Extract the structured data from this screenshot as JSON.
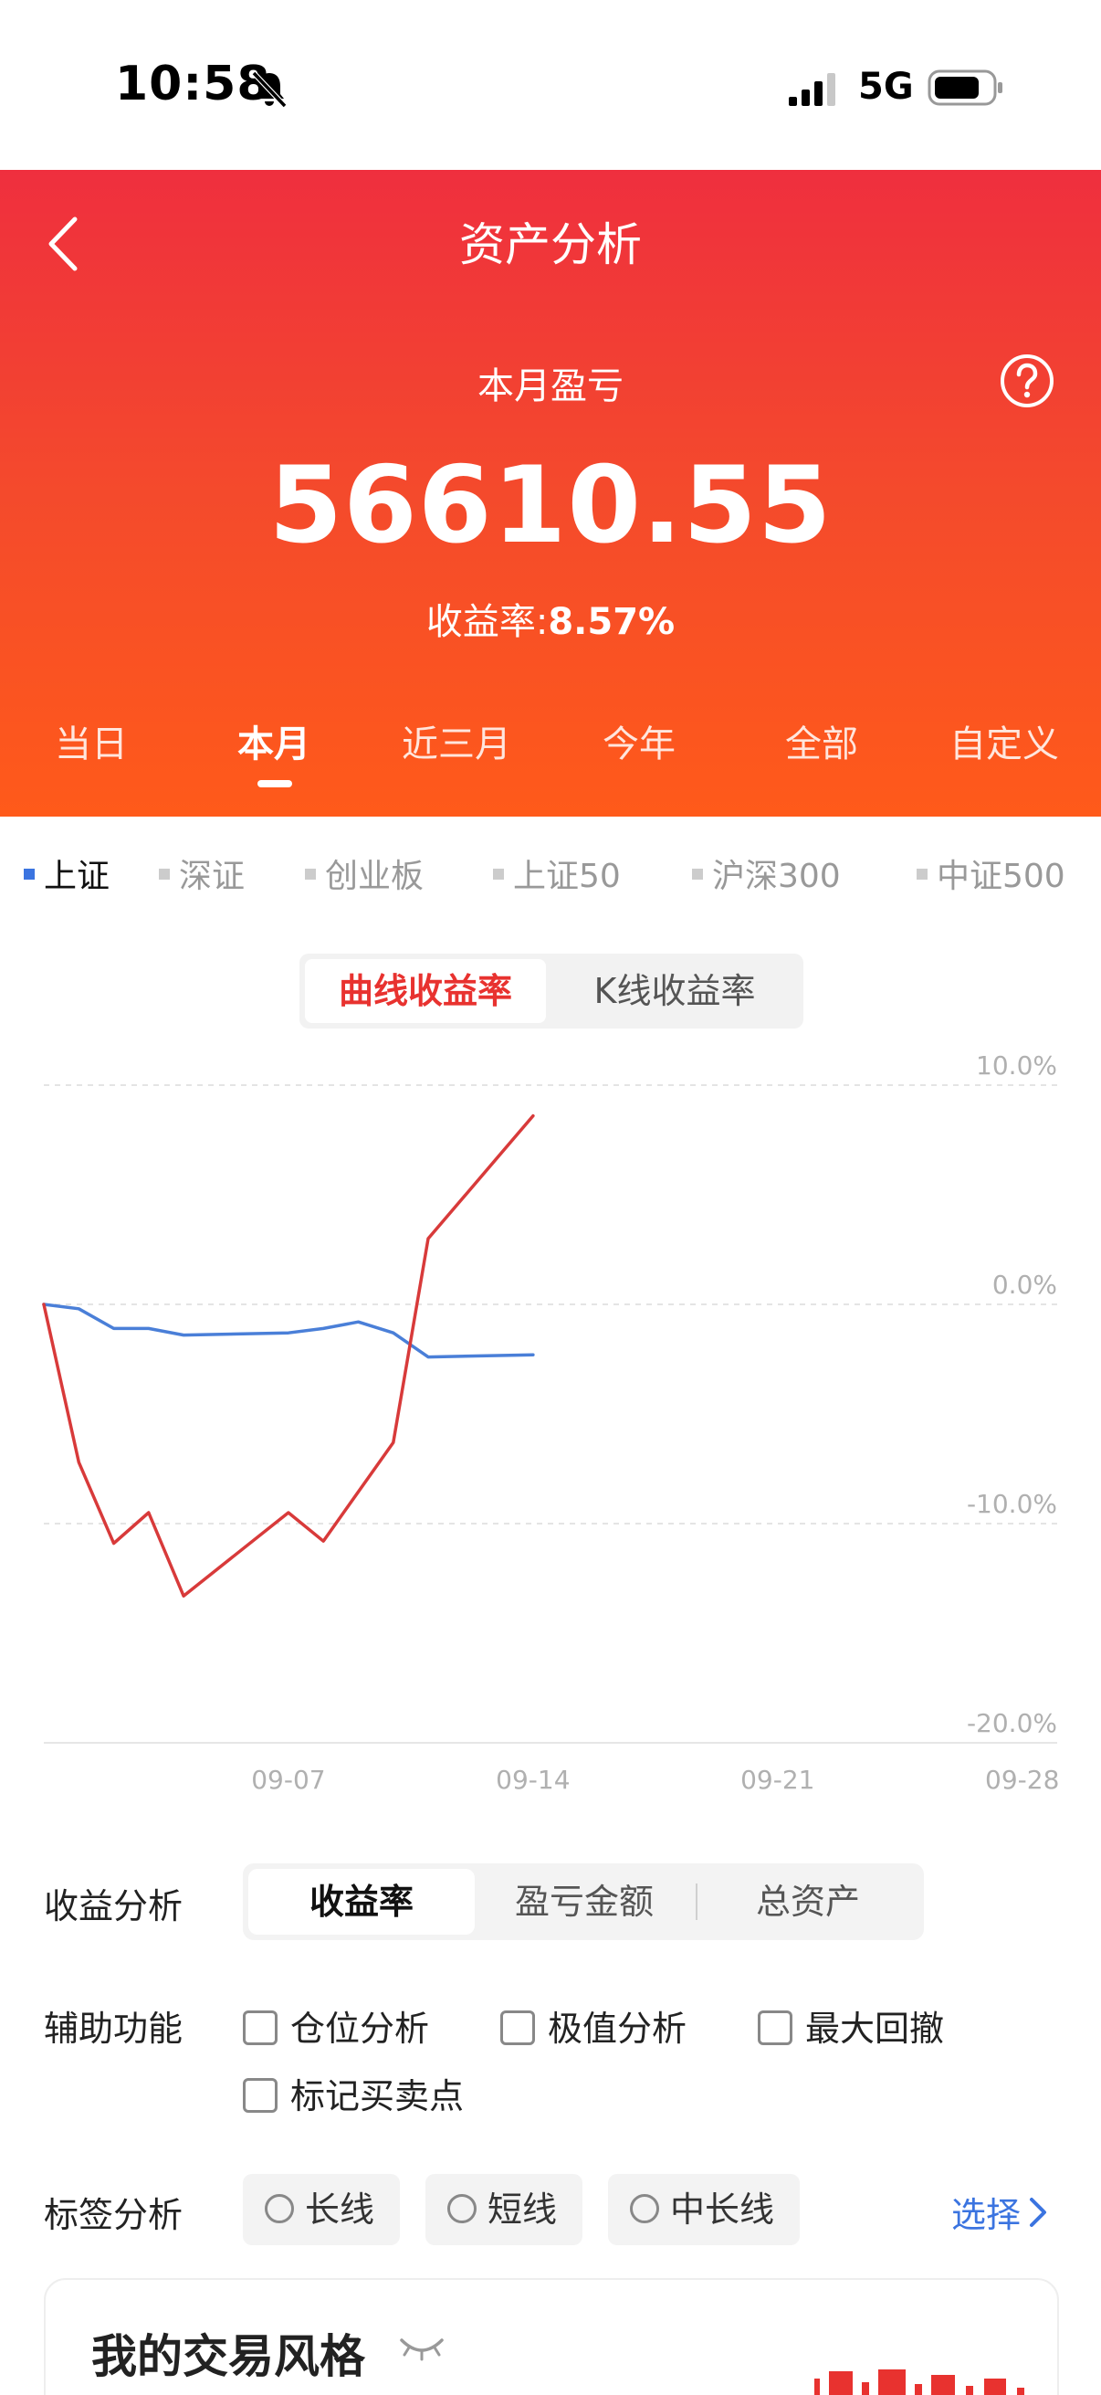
{
  "status_bar": {
    "time": "10:58",
    "network": "5G"
  },
  "header": {
    "title": "资产分析",
    "month_label": "本月盈亏",
    "month_value": "56610.55",
    "rate_label": "收益率:",
    "rate_value": "8.57%"
  },
  "period_tabs": [
    {
      "label": "当日"
    },
    {
      "label": "本月"
    },
    {
      "label": "近三月"
    },
    {
      "label": "今年"
    },
    {
      "label": "全部"
    },
    {
      "label": "自定义"
    }
  ],
  "active_period": "本月",
  "indices": [
    {
      "label": "上证"
    },
    {
      "label": "深证"
    },
    {
      "label": "创业板"
    },
    {
      "label": "上证50"
    },
    {
      "label": "沪深300"
    },
    {
      "label": "中证500"
    }
  ],
  "chart_modes": [
    {
      "label": "曲线收益率"
    },
    {
      "label": "K线收益率"
    }
  ],
  "colors": {
    "accent": "#e8322f",
    "index_line": "#4a7fd8",
    "link": "#3b74e0"
  },
  "chart_data": {
    "type": "line",
    "ylim": [
      -20,
      10
    ],
    "y_ticks": [
      "10.0%",
      "0.0%",
      "-10.0%",
      "-20.0%"
    ],
    "y_tick_values": [
      10,
      0,
      -10,
      -20
    ],
    "x_ticks": [
      "09-07",
      "09-14",
      "09-21",
      "09-28"
    ],
    "x_tick_days": [
      7,
      14,
      21,
      28
    ],
    "xlim": [
      0,
      29
    ],
    "grid": true,
    "series": [
      {
        "color": "#d83a3a",
        "x": [
          0,
          1,
          2,
          3,
          4,
          7,
          8,
          10,
          11,
          14
        ],
        "y": [
          0.0,
          -7.2,
          -10.9,
          -9.5,
          -13.3,
          -9.5,
          -10.8,
          -6.3,
          3.0,
          8.6
        ]
      },
      {
        "color": "#4a7fd8",
        "x": [
          0,
          1,
          2,
          3,
          4,
          7,
          8,
          9,
          10,
          11,
          14
        ],
        "y": [
          0.0,
          -0.2,
          -1.1,
          -1.1,
          -1.4,
          -1.3,
          -1.1,
          -0.8,
          -1.3,
          -2.4,
          -2.3
        ]
      }
    ]
  },
  "analysis": {
    "label": "收益分析",
    "options": [
      {
        "label": "收益率"
      },
      {
        "label": "盈亏金额"
      },
      {
        "label": "总资产"
      }
    ]
  },
  "aux": {
    "label": "辅助功能",
    "options": [
      {
        "label": "仓位分析"
      },
      {
        "label": "极值分析"
      },
      {
        "label": "最大回撤"
      },
      {
        "label": "标记买卖点"
      }
    ]
  },
  "tags": {
    "label": "标签分析",
    "options": [
      {
        "label": "长线"
      },
      {
        "label": "短线"
      },
      {
        "label": "中长线"
      }
    ],
    "select_label": "选择"
  },
  "style_card": {
    "title": "我的交易风格"
  }
}
